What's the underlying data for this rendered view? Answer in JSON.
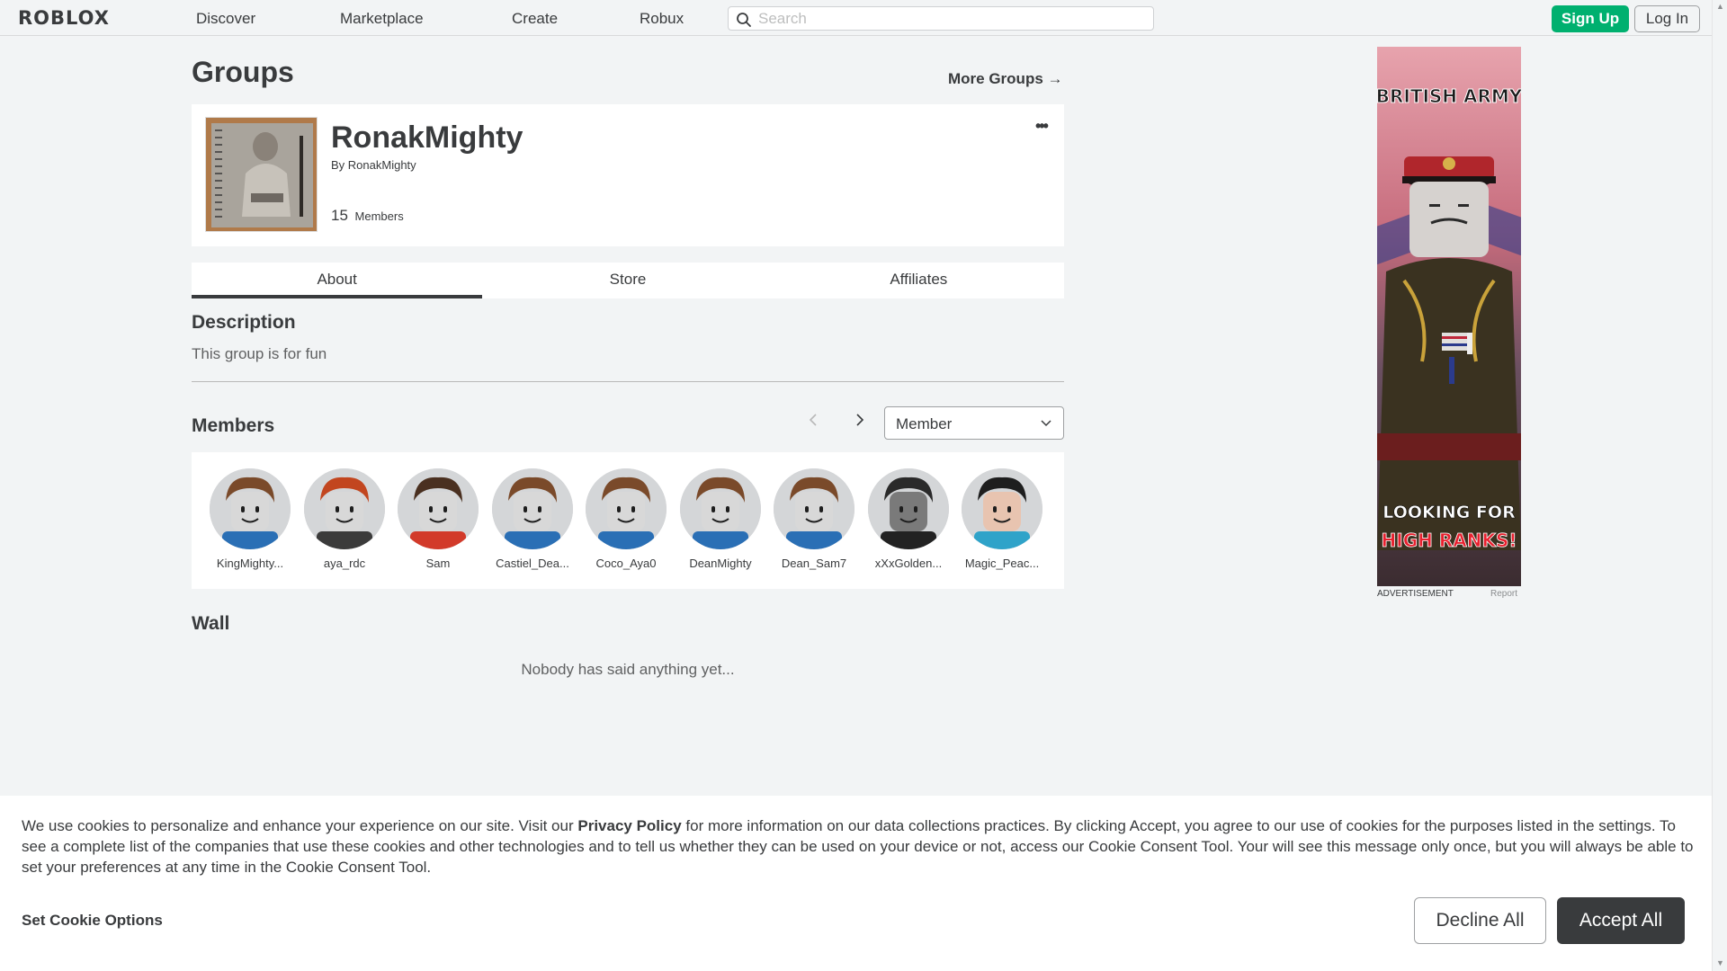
{
  "nav": {
    "logo": "ROBLOX",
    "links": [
      "Discover",
      "Marketplace",
      "Create",
      "Robux"
    ],
    "search_placeholder": "Search",
    "signup": "Sign Up",
    "login": "Log In"
  },
  "page": {
    "title": "Groups",
    "more_groups": "More Groups →"
  },
  "group": {
    "name": "RonakMighty",
    "by_prefix": "By",
    "owner": "RonakMighty",
    "member_count": "15",
    "member_label": "Members",
    "more_icon": "more-horizontal-icon"
  },
  "tabs": [
    {
      "label": "About",
      "active": true
    },
    {
      "label": "Store",
      "active": false
    },
    {
      "label": "Affiliates",
      "active": false
    }
  ],
  "about": {
    "description_title": "Description",
    "description": "This group is for fun",
    "members_title": "Members",
    "role_selected": "Member",
    "wall_title": "Wall",
    "wall_empty": "Nobody has said anything yet..."
  },
  "members": [
    {
      "name": "KingMighty...",
      "hair": "#7a4a2a",
      "shirt": "#2a6fb5",
      "skin": "#d8d8d8"
    },
    {
      "name": "aya_rdc",
      "hair": "#c2461f",
      "shirt": "#3b3b3b",
      "skin": "#d8d8d8"
    },
    {
      "name": "Sam",
      "hair": "#4a3020",
      "shirt": "#d23a2a",
      "skin": "#d8d8d8"
    },
    {
      "name": "Castiel_Dea...",
      "hair": "#7a4a2a",
      "shirt": "#2a6fb5",
      "skin": "#d8d8d8"
    },
    {
      "name": "Coco_Aya0",
      "hair": "#7a4a2a",
      "shirt": "#2a6fb5",
      "skin": "#d8d8d8"
    },
    {
      "name": "DeanMighty",
      "hair": "#7a4a2a",
      "shirt": "#2a6fb5",
      "skin": "#d8d8d8"
    },
    {
      "name": "Dean_Sam7",
      "hair": "#7a4a2a",
      "shirt": "#2a6fb5",
      "skin": "#d8d8d8"
    },
    {
      "name": "xXxGolden...",
      "hair": "#2a2a2a",
      "shirt": "#222222",
      "skin": "#7a7a7a"
    },
    {
      "name": "Magic_Peac...",
      "hair": "#1e1e1e",
      "shirt": "#2fa3c9",
      "skin": "#e8c4b0"
    }
  ],
  "ad": {
    "headline_top": "BRITISH ARMY",
    "headline_mid": "LOOKING FOR",
    "headline_bottom": "HIGH RANKS!",
    "label": "ADVERTISEMENT",
    "report": "Report"
  },
  "cookie": {
    "text_before": "We use cookies to personalize and enhance your experience on our site. Visit our ",
    "policy_link": "Privacy Policy",
    "text_after": " for more information on our data collections practices. By clicking Accept, you agree to our use of cookies for the purposes listed in the settings. To see a complete list of the companies that use these cookies and other technologies and to tell us whether they can be used on your device or not, access our Cookie Consent Tool. Your will see this message only once, but you will always be able to set your preferences at any time in the Cookie Consent Tool.",
    "options": "Set Cookie Options",
    "decline": "Decline All",
    "accept": "Accept All"
  },
  "colors": {
    "brand_green": "#00b06f",
    "text_dark": "#393b3d",
    "background": "#f2f4f5"
  }
}
